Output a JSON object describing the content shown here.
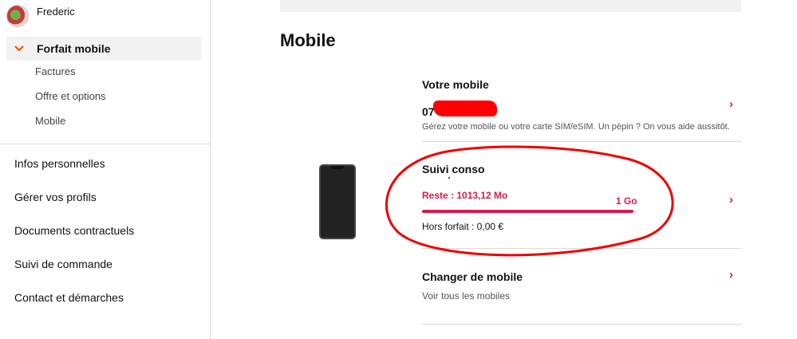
{
  "sidebar": {
    "user_name": "Frederic",
    "active_section": "Forfait mobile",
    "sub_items": [
      "Factures",
      "Offre et options",
      "Mobile"
    ],
    "items": [
      "Infos personnelles",
      "Gérer vos profils",
      "Documents contractuels",
      "Suivi de commande",
      "Contact et démarches"
    ]
  },
  "main": {
    "title": "Mobile",
    "votre_mobile": {
      "title": "Votre mobile",
      "number_prefix": "07",
      "desc": "Gérez votre mobile ou votre carte SIM/eSIM. Un pépin ? On vous aide aussitôt."
    },
    "suivi_conso": {
      "title": "Suivi conso",
      "reste": "Reste : 1013,12 Mo",
      "limit": "1 Go",
      "remaining_fraction": 0.99,
      "hors_forfait": "Hors forfait : 0,00 €"
    },
    "changer_mobile": {
      "title": "Changer de mobile",
      "desc": "Voir tous les mobiles"
    }
  },
  "icons": {
    "chevron_right": "›",
    "chevron_down": "⌄"
  },
  "colors": {
    "accent": "#d11d4a",
    "orange": "#ef5a00",
    "annotation": "#ee0000"
  }
}
